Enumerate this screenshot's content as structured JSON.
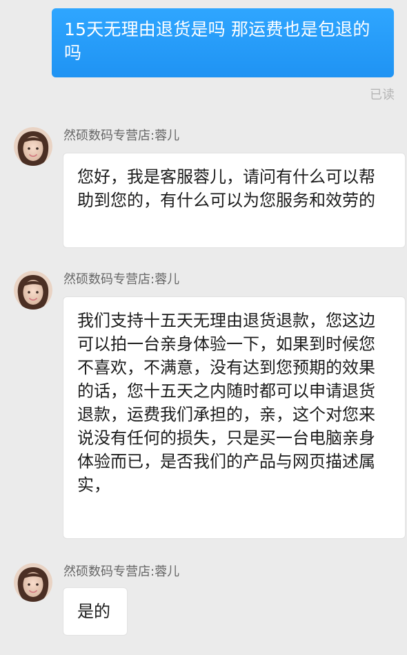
{
  "conversation": {
    "messages": [
      {
        "type": "outgoing",
        "text": "15天无理由退货是吗  那运费也是包退的吗",
        "status": "已读"
      },
      {
        "type": "incoming",
        "sender": "然硕数码专营店:蓉儿",
        "text": "您好，我是客服蓉儿，请问有什么可以帮助到您的，有什么可以为您服务和效劳的"
      },
      {
        "type": "incoming",
        "sender": "然硕数码专营店:蓉儿",
        "text": "我们支持十五天无理由退货退款，您这边可以拍一台亲身体验一下，如果到时候您不喜欢，不满意，没有达到您预期的效果的话，您十五天之内随时都可以申请退货退款，运费我们承担的，亲，这个对您来说没有任何的损失，只是买一台电脑亲身体验而已，是否我们的产品与网页描述属实，"
      },
      {
        "type": "incoming",
        "sender": "然硕数码专营店:蓉儿",
        "text": "是的"
      }
    ]
  },
  "colors": {
    "background": "#ebebeb",
    "outgoing_bubble": "#1f93f3",
    "incoming_bubble": "#ffffff",
    "read_status": "#b4b4b4",
    "sender_name": "#666666"
  },
  "icons": {
    "avatar": "agent-avatar-icon"
  }
}
